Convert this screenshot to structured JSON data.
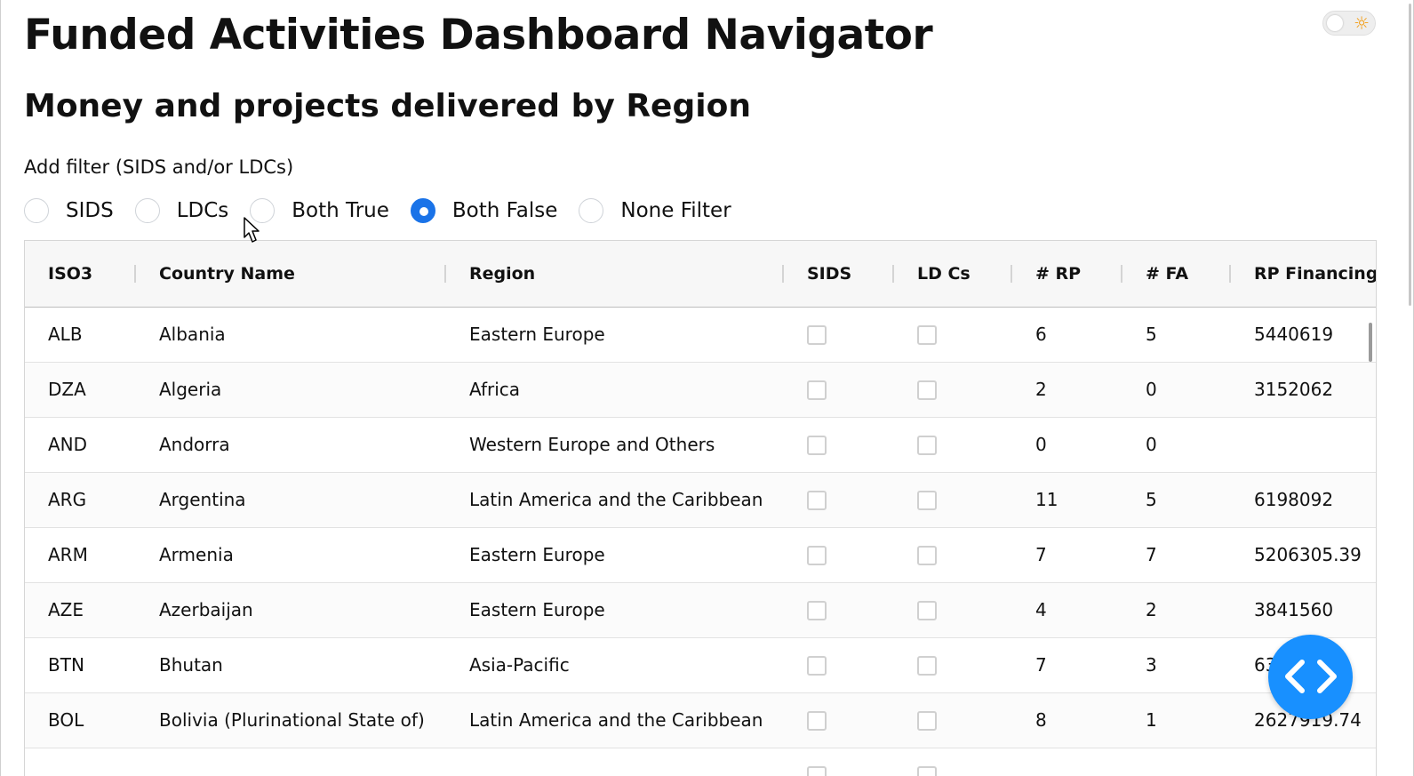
{
  "app": {
    "title": "Funded Activities Dashboard Navigator"
  },
  "section": {
    "title": "Money and projects delivered by Region"
  },
  "filter": {
    "label": "Add filter (SIDS and/or LDCs)",
    "options": [
      {
        "label": "SIDS",
        "selected": false
      },
      {
        "label": "LDCs",
        "selected": false
      },
      {
        "label": "Both True",
        "selected": false
      },
      {
        "label": "Both False",
        "selected": true
      },
      {
        "label": "None Filter",
        "selected": false
      }
    ],
    "selected_color": "#1a73e8"
  },
  "theme_toggle": {
    "icon": "sun-icon",
    "state": "light"
  },
  "table": {
    "columns": [
      "ISO3",
      "Country Name",
      "Region",
      "SIDS",
      "LD Cs",
      "# RP",
      "# FA",
      "RP Financing $"
    ],
    "rows": [
      {
        "iso3": "ALB",
        "country": "Albania",
        "region": "Eastern Europe",
        "sids": false,
        "ldcs": false,
        "rp": "6",
        "fa": "5",
        "financing": "5440619"
      },
      {
        "iso3": "DZA",
        "country": "Algeria",
        "region": "Africa",
        "sids": false,
        "ldcs": false,
        "rp": "2",
        "fa": "0",
        "financing": "3152062"
      },
      {
        "iso3": "AND",
        "country": "Andorra",
        "region": "Western Europe and Others",
        "sids": false,
        "ldcs": false,
        "rp": "0",
        "fa": "0",
        "financing": ""
      },
      {
        "iso3": "ARG",
        "country": "Argentina",
        "region": "Latin America and the Caribbean",
        "sids": false,
        "ldcs": false,
        "rp": "11",
        "fa": "5",
        "financing": "6198092"
      },
      {
        "iso3": "ARM",
        "country": "Armenia",
        "region": "Eastern Europe",
        "sids": false,
        "ldcs": false,
        "rp": "7",
        "fa": "7",
        "financing": "5206305.39"
      },
      {
        "iso3": "AZE",
        "country": "Azerbaijan",
        "region": "Eastern Europe",
        "sids": false,
        "ldcs": false,
        "rp": "4",
        "fa": "2",
        "financing": "3841560"
      },
      {
        "iso3": "BTN",
        "country": "Bhutan",
        "region": "Asia-Pacific",
        "sids": false,
        "ldcs": false,
        "rp": "7",
        "fa": "3",
        "financing": "63"
      },
      {
        "iso3": "BOL",
        "country": "Bolivia (Plurinational State of)",
        "region": "Latin America and the Caribbean",
        "sids": false,
        "ldcs": false,
        "rp": "8",
        "fa": "1",
        "financing": "2627919.74"
      },
      {
        "iso3": "",
        "country": "",
        "region": "",
        "sids": false,
        "ldcs": false,
        "rp": "",
        "fa": "",
        "financing": ""
      }
    ]
  },
  "fab": {
    "icon": "code-icon",
    "color": "#1890ff"
  }
}
